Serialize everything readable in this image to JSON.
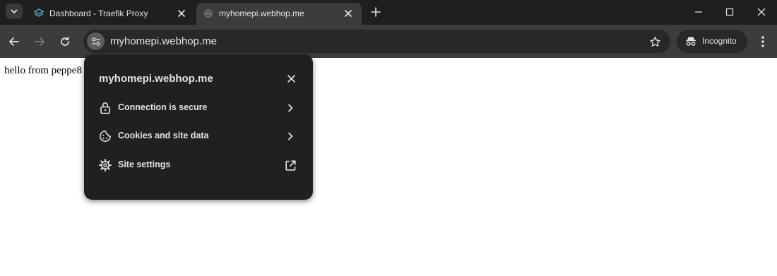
{
  "tabs": [
    {
      "title": "Dashboard - Traefik Proxy",
      "favicon": "traefik-logo",
      "active": false
    },
    {
      "title": "myhomepi.webhop.me",
      "favicon": "globe-icon",
      "active": true
    }
  ],
  "toolbar": {
    "url": "myhomepi.webhop.me",
    "profile_label": "Incognito"
  },
  "page": {
    "body_text": "hello from peppe8"
  },
  "site_popup": {
    "title": "myhomepi.webhop.me",
    "items": [
      {
        "label": "Connection is secure",
        "icon": "lock-icon",
        "action": "chevron-right-icon"
      },
      {
        "label": "Cookies and site data",
        "icon": "cookie-icon",
        "action": "chevron-right-icon"
      },
      {
        "label": "Site settings",
        "icon": "gear-icon",
        "action": "open-external-icon"
      }
    ]
  },
  "colors": {
    "tabstrip_bg": "#1f1f1f",
    "toolbar_bg": "#3c3c3c",
    "omnibox_bg": "#282828",
    "popup_bg": "#202020",
    "text_light": "#e3e3e3"
  }
}
